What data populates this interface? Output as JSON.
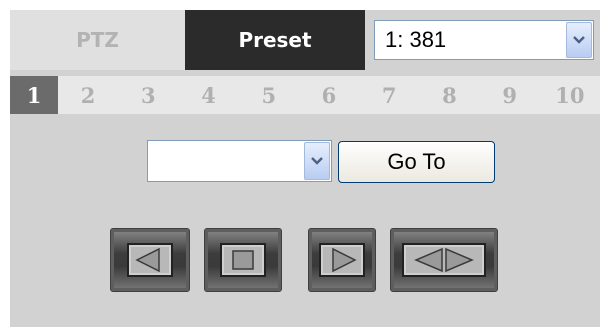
{
  "tabs": [
    {
      "label": "PTZ",
      "active": false
    },
    {
      "label": "Preset",
      "active": true
    }
  ],
  "preset_select": {
    "value": "1: 381"
  },
  "pages": {
    "items": [
      "1",
      "2",
      "3",
      "4",
      "5",
      "6",
      "7",
      "8",
      "9",
      "10"
    ],
    "active": "1"
  },
  "goto": {
    "select_value": "",
    "button_label": "Go To"
  },
  "nav_buttons": [
    {
      "icon": "left-arrow-icon"
    },
    {
      "icon": "stop-icon"
    },
    {
      "icon": "right-arrow-icon"
    },
    {
      "icon": "left-right-arrow-icon"
    }
  ],
  "colors": {
    "panel_bg": "#d2d2d2",
    "active_tab_bg": "#2b2b2b",
    "active_page_bg": "#6b6b6b",
    "inactive_text": "#b0b0b0"
  }
}
